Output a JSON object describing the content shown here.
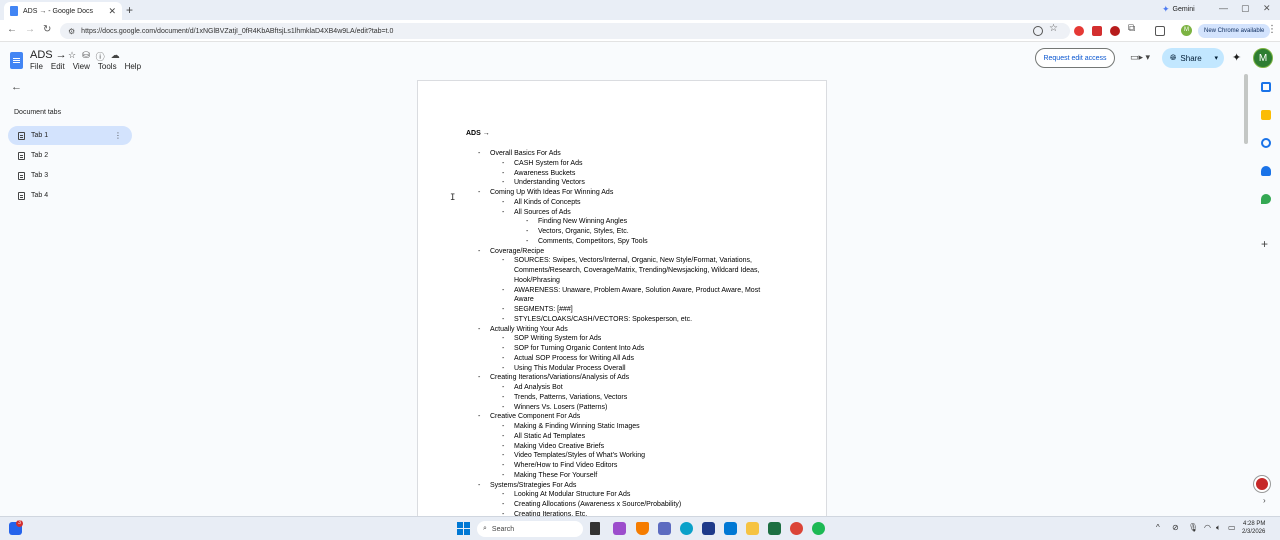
{
  "browser": {
    "tab_title": "ADS → - Google Docs",
    "url": "https://docs.google.com/document/d/1xNGlBVZatjI_0fR4KbABftsjLs1lhmklaD4XB4w9LA/edit?tab=t.0",
    "gemini_label": "Gemini",
    "new_chrome_label": "New Chrome available",
    "profile_initial": "M"
  },
  "docs": {
    "title": "ADS →",
    "menu": [
      "File",
      "Edit",
      "View",
      "Tools",
      "Help"
    ],
    "request_edit_label": "Request edit access",
    "share_label": "Share",
    "avatar_initial": "M"
  },
  "sidebar": {
    "heading": "Document tabs",
    "tabs": [
      {
        "label": "Tab 1",
        "active": true
      },
      {
        "label": "Tab 2",
        "active": false
      },
      {
        "label": "Tab 3",
        "active": false
      },
      {
        "label": "Tab 4",
        "active": false
      }
    ]
  },
  "document": {
    "heading": "ADS →",
    "outline": [
      {
        "level": 1,
        "text": "Overall Basics For Ads"
      },
      {
        "level": 2,
        "text": "CASH System for Ads"
      },
      {
        "level": 2,
        "text": "Awareness Buckets"
      },
      {
        "level": 2,
        "text": "Understanding Vectors"
      },
      {
        "level": 1,
        "text": "Coming Up With Ideas For Winning Ads"
      },
      {
        "level": 2,
        "text": "All Kinds of Concepts"
      },
      {
        "level": 2,
        "text": "All Sources of Ads"
      },
      {
        "level": 3,
        "text": "Finding New Winning Angles"
      },
      {
        "level": 3,
        "text": "Vectors, Organic, Styles, Etc."
      },
      {
        "level": 3,
        "text": "Comments, Competitors, Spy Tools"
      },
      {
        "level": 1,
        "text": "Coverage/Recipe"
      },
      {
        "level": 2,
        "text": "SOURCES: Swipes, Vectors/Internal, Organic, New Style/Format, Variations, Comments/Research, Coverage/Matrix, Trending/Newsjacking, Wildcard Ideas, Hook/Phrasing"
      },
      {
        "level": 2,
        "text": "AWARENESS: Unaware, Problem Aware, Solution Aware, Product Aware, Most Aware"
      },
      {
        "level": 2,
        "text": "SEGMENTS: [###]"
      },
      {
        "level": 2,
        "text": "STYLES/CLOAKS/CASH/VECTORS: Spokesperson, etc."
      },
      {
        "level": 1,
        "text": "Actually Writing Your Ads"
      },
      {
        "level": 2,
        "text": "SOP Writing System for Ads"
      },
      {
        "level": 2,
        "text": "SOP for Turning Organic Content Into Ads"
      },
      {
        "level": 2,
        "text": "Actual SOP Process for Writing All Ads"
      },
      {
        "level": 2,
        "text": "Using This Modular Process Overall"
      },
      {
        "level": 1,
        "text": "Creating Iterations/Variations/Analysis of Ads"
      },
      {
        "level": 2,
        "text": "Ad Analysis Bot"
      },
      {
        "level": 2,
        "text": "Trends, Patterns, Variations, Vectors"
      },
      {
        "level": 2,
        "text": "Winners Vs. Losers (Patterns)"
      },
      {
        "level": 1,
        "text": "Creative Component For Ads"
      },
      {
        "level": 2,
        "text": "Making & Finding Winning Static Images"
      },
      {
        "level": 2,
        "text": "All Static Ad Templates"
      },
      {
        "level": 2,
        "text": "Making Video Creative Briefs"
      },
      {
        "level": 2,
        "text": "Video Templates/Styles of What’s Working"
      },
      {
        "level": 2,
        "text": "Where/How to Find Video Editors"
      },
      {
        "level": 2,
        "text": "Making These For Yourself"
      },
      {
        "level": 1,
        "text": "Systems/Strategies For Ads"
      },
      {
        "level": 2,
        "text": "Looking At Modular Structure For Ads"
      },
      {
        "level": 2,
        "text": "Creating Allocations (Awareness x Source/Probability)"
      },
      {
        "level": 2,
        "text": "Creating Iterations, Etc."
      }
    ]
  },
  "taskbar": {
    "search_placeholder": "Search",
    "time": "4:28 PM",
    "date": "2/3/2026",
    "notification_count": "3"
  }
}
